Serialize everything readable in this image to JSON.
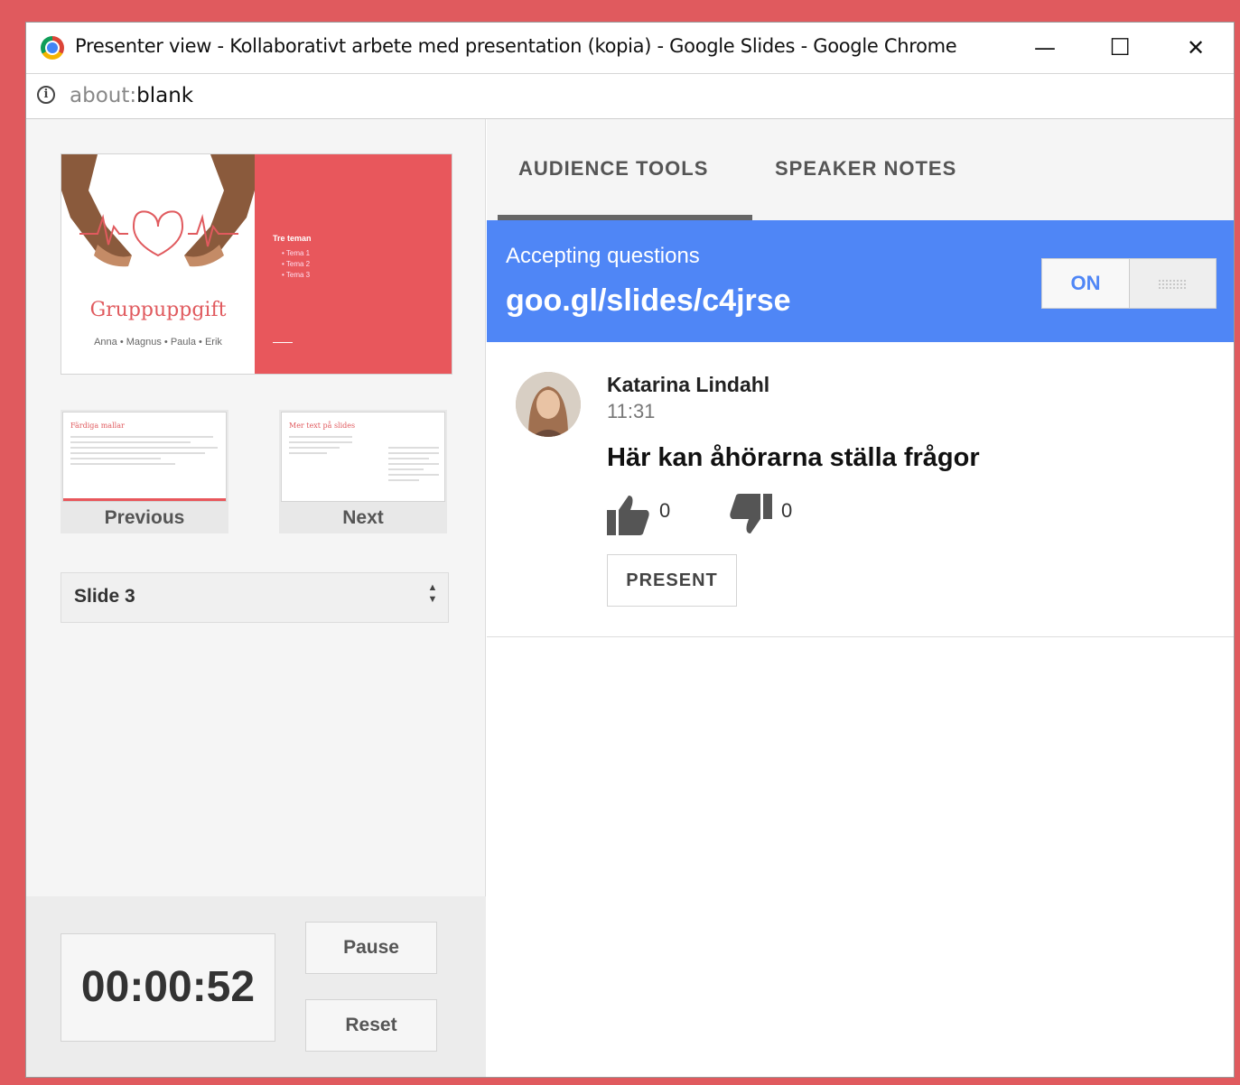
{
  "window": {
    "title": "Presenter view - Kollaborativt arbete med presentation (kopia) - Google Slides - Google Chrome",
    "minimize": "—",
    "maximize": "☐",
    "close": "✕"
  },
  "address": {
    "scheme": "about:",
    "rest": "blank"
  },
  "current_slide": {
    "title": "Gruppuppgift",
    "subtitle": "Anna • Magnus • Paula • Erik",
    "panel_heading": "Tre teman",
    "panel_items": [
      "Tema 1",
      "Tema 2",
      "Tema 3"
    ]
  },
  "navigation": {
    "previous_label": "Previous",
    "previous_thumb_title": "Färdiga mallar",
    "next_label": "Next",
    "next_thumb_title": "Mer text på slides"
  },
  "slide_select": {
    "value": "Slide 3"
  },
  "timer": {
    "value": "00:00:52",
    "pause_label": "Pause",
    "reset_label": "Reset"
  },
  "tabs": {
    "audience_tools": "AUDIENCE TOOLS",
    "speaker_notes": "SPEAKER NOTES"
  },
  "qa": {
    "status": "Accepting questions",
    "link": "goo.gl/slides/c4jrse",
    "toggle_label": "ON"
  },
  "question": {
    "author": "Katarina Lindahl",
    "time": "11:31",
    "text": "Här kan åhörarna ställa frågor",
    "likes": "0",
    "dislikes": "0",
    "present_label": "PRESENT"
  },
  "colors": {
    "background": "#e05a5e",
    "accent_blue": "#4f86f6",
    "slide_red": "#e8575c"
  }
}
